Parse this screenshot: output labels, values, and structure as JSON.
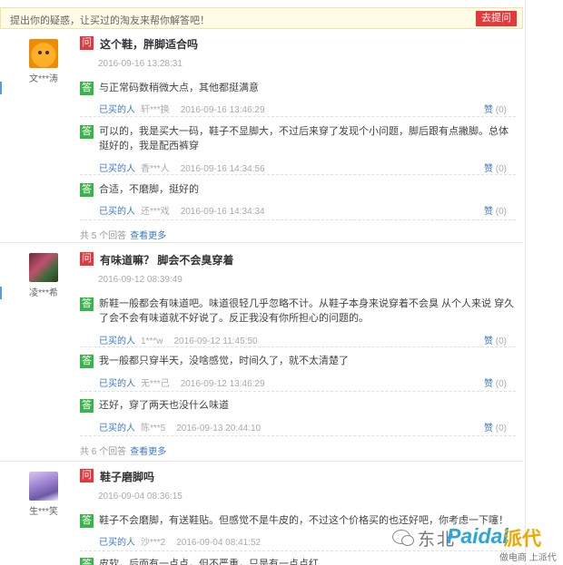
{
  "topbar": {
    "prompt": "提出你的疑惑，让买过的淘友来帮你解答吧！",
    "ask_button": "去提问"
  },
  "labels": {
    "q_tag": "问",
    "a_tag": "答",
    "bought": "已买的人",
    "like": "赞",
    "view_more": "查看更多"
  },
  "questions": [
    {
      "user": "文***涛",
      "question": "这个鞋，胖脚适合吗",
      "date": "2016-09-16 13:28:31",
      "answers": [
        {
          "text": "与正常码数稍微大点，其他都挺满意",
          "user": "轩***换",
          "date": "2016-09-16 13:46:29",
          "likes": "(0)"
        },
        {
          "text": "可以的，我是买大一码，鞋子不显脚大，不过后来穿了发现个小问题，脚后跟有点撇脚。总体挺好的，我是配西裤穿",
          "user": "香***人",
          "date": "2016-09-16 14:34:56",
          "likes": "(0)"
        },
        {
          "text": "合适，不磨脚，挺好的",
          "user": "还***戏",
          "date": "2016-09-16 14:34:34",
          "likes": "(0)"
        }
      ],
      "total": "共 5 个回答"
    },
    {
      "user": "凌***希",
      "question": "有味道嘛？ 脚会不会臭穿着",
      "date": "2016-09-12 08:39:49",
      "answers": [
        {
          "text": "新鞋一般都会有味道吧。味道很轻几乎忽略不计。从鞋子本身来说穿着不会臭 从个人来说 穿久了会不会有味道就不好说了。反正我没有你所担心的问题的。",
          "user": "1***w",
          "date": "2016-09-12 11:45:50",
          "likes": "(0)"
        },
        {
          "text": "我一般都只穿半天，没啥感觉，时间久了，就不太清楚了",
          "user": "无***己",
          "date": "2016-09-12 13:46:29",
          "likes": "(0)"
        },
        {
          "text": "还好，穿了两天也没什么味道",
          "user": "陈***5",
          "date": "2016-09-13 20:44:10",
          "likes": "(0)"
        }
      ],
      "total": "共 6 个回答"
    },
    {
      "user": "生***笑",
      "question": "鞋子磨脚吗",
      "date": "2016-09-04 08:36:15",
      "answers": [
        {
          "text": "鞋子不会磨脚，有送鞋贴。但感觉不是牛皮的，不过这个价格买的也还好吧，你考虑一下噻！",
          "user": "沙***2",
          "date": "2016-09-04 08:41:52",
          "likes": "(0)"
        },
        {
          "text": "皮软，后面有一点点，但不严重，只是有一点点红",
          "user": "",
          "date": "",
          "likes": ""
        }
      ]
    }
  ],
  "watermark": {
    "cn": "东北",
    "logo": "Paidai",
    "logo2": "派代",
    "slogan": "做电商 上派代"
  }
}
